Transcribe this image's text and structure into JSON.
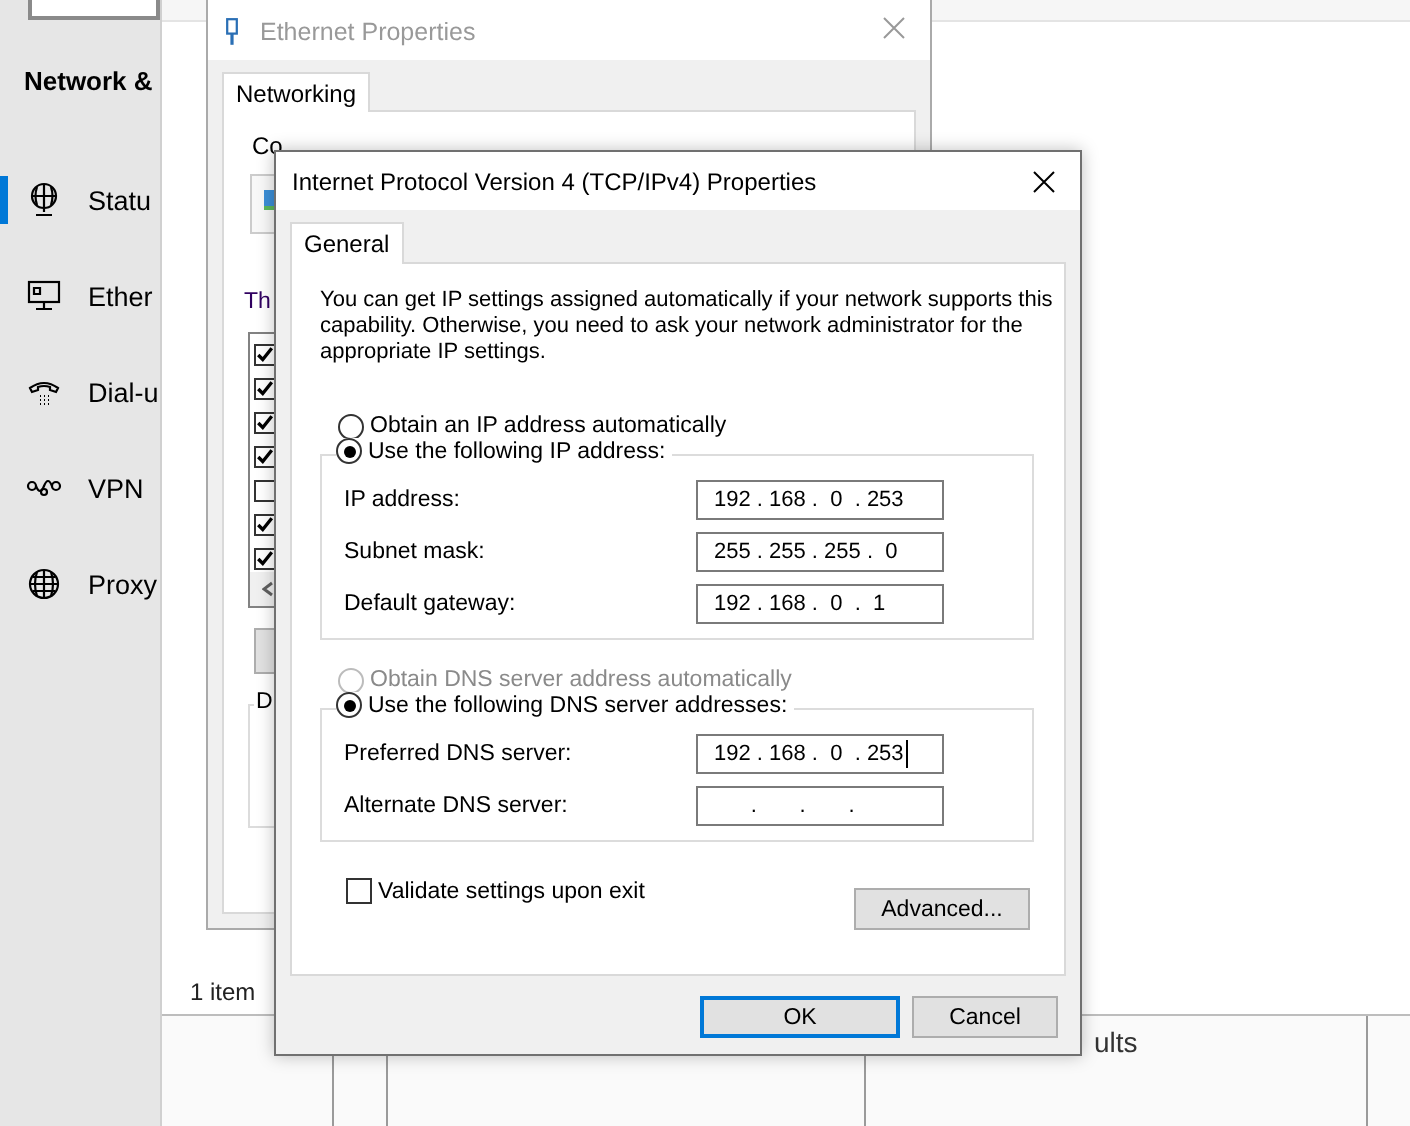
{
  "settings": {
    "title": "Network &",
    "items": [
      {
        "label": "Statu",
        "selected": true
      },
      {
        "label": "Ether",
        "selected": false
      },
      {
        "label": "Dial-u",
        "selected": false
      },
      {
        "label": "VPN",
        "selected": false
      },
      {
        "label": "Proxy",
        "selected": false
      }
    ]
  },
  "connections_window": {
    "status": "1 item",
    "column_text": "ults"
  },
  "ethernet_properties": {
    "title": "Ethernet Properties",
    "tabs": [
      {
        "label": "Networking",
        "selected": true
      }
    ],
    "connect_label": "Co",
    "list_label": "Th",
    "group_label": "D",
    "components": [
      {
        "checked": true
      },
      {
        "checked": true
      },
      {
        "checked": true
      },
      {
        "checked": true
      },
      {
        "checked": false
      },
      {
        "checked": true
      },
      {
        "checked": true
      }
    ]
  },
  "ipv4_dialog": {
    "title": "Internet Protocol Version 4 (TCP/IPv4) Properties",
    "tabs": [
      {
        "label": "General",
        "selected": true
      }
    ],
    "description": "You can get IP settings assigned automatically if your network supports this capability. Otherwise, you need to ask your network administrator for the appropriate IP settings.",
    "ip_options": [
      {
        "label": "Obtain an IP address automatically",
        "selected": false,
        "disabled": false
      },
      {
        "label": "Use the following IP address:",
        "selected": true,
        "disabled": false
      }
    ],
    "ip_fields": [
      {
        "label": "IP address:",
        "value": "192 . 168 .  0  . 253",
        "focused": false
      },
      {
        "label": "Subnet mask:",
        "value": "255 . 255 . 255 .  0",
        "focused": false
      },
      {
        "label": "Default gateway:",
        "value": "192 . 168 .  0  .  1",
        "focused": false
      }
    ],
    "dns_options": [
      {
        "label": "Obtain DNS server address automatically",
        "selected": false,
        "disabled": true
      },
      {
        "label": "Use the following DNS server addresses:",
        "selected": true,
        "disabled": false
      }
    ],
    "dns_fields": [
      {
        "label": "Preferred DNS server:",
        "value": "192 . 168 .  0  . 253",
        "focused": true
      },
      {
        "label": "Alternate DNS server:",
        "value": "      .       .       .",
        "focused": false
      }
    ],
    "validate": {
      "label": "Validate settings upon exit",
      "checked": false
    },
    "advanced_button": "Advanced...",
    "buttons": [
      {
        "label": "OK",
        "default": true
      },
      {
        "label": "Cancel",
        "default": false
      }
    ]
  }
}
